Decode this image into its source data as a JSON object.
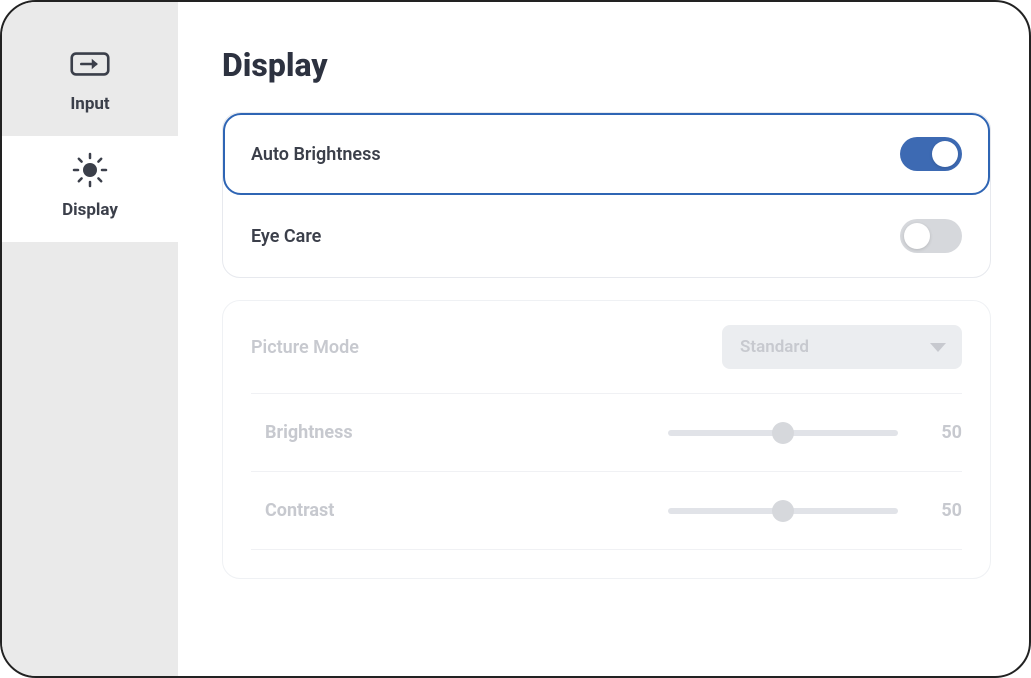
{
  "sidebar": {
    "items": [
      {
        "label": "Input",
        "icon": "input-icon",
        "active": false
      },
      {
        "label": "Display",
        "icon": "sun-icon",
        "active": true
      }
    ]
  },
  "page": {
    "title": "Display"
  },
  "toggles": {
    "auto_brightness": {
      "label": "Auto Brightness",
      "value": true,
      "selected": true
    },
    "eye_care": {
      "label": "Eye Care",
      "value": false,
      "selected": false
    }
  },
  "picture": {
    "mode_label": "Picture Mode",
    "mode_value": "Standard",
    "brightness_label": "Brightness",
    "brightness_value": "50",
    "contrast_label": "Contrast",
    "contrast_value": "50"
  },
  "colors": {
    "accent": "#3d6ab3",
    "selection_border": "#2f65b4",
    "text_primary": "#3b3f4a",
    "text_disabled": "#c7c9cf",
    "sidebar_bg": "#eaeaea"
  }
}
